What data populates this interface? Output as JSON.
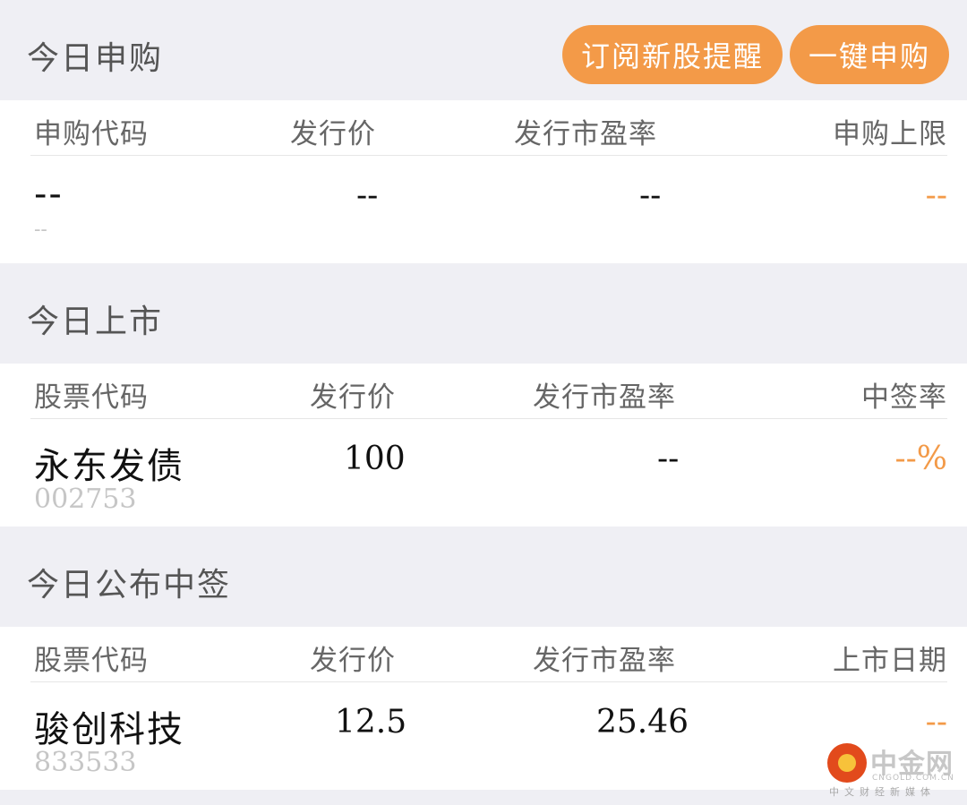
{
  "colors": {
    "accent": "#f39a48",
    "background": "#efeff4",
    "card": "#ffffff"
  },
  "buttons": {
    "subscribe_alert": "订阅新股提醒",
    "one_key_subscribe": "一键申购"
  },
  "today_subscribe": {
    "title": "今日申购",
    "headers": [
      "申购代码",
      "发行价",
      "发行市盈率",
      "申购上限"
    ],
    "row": {
      "name": "--",
      "code": "--",
      "price": "--",
      "pe": "--",
      "limit": "--"
    }
  },
  "today_listing": {
    "title": "今日上市",
    "headers": [
      "股票代码",
      "发行价",
      "发行市盈率",
      "中签率"
    ],
    "row": {
      "name": "永东发债",
      "code": "002753",
      "price": "100",
      "pe": "--",
      "rate": "--%"
    }
  },
  "today_lottery": {
    "title": "今日公布中签",
    "headers": [
      "股票代码",
      "发行价",
      "发行市盈率",
      "上市日期"
    ],
    "row": {
      "name": "骏创科技",
      "code": "833533",
      "price": "12.5",
      "pe": "25.46",
      "date": "--"
    }
  },
  "watermark": {
    "brand": "中金网",
    "domain": "CNGOLD.COM.CN",
    "slogan": "中文财经新媒体"
  }
}
